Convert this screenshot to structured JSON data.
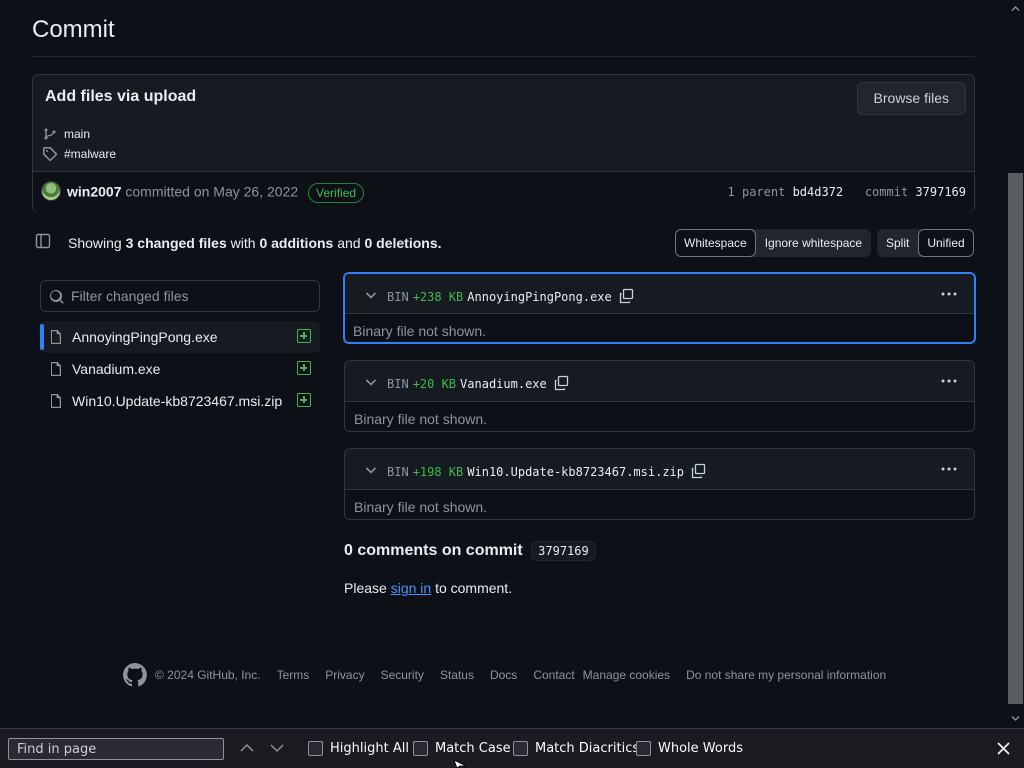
{
  "page": {
    "title": "Commit"
  },
  "commit": {
    "message": "Add files via upload",
    "browse_label": "Browse files",
    "branch": "main",
    "tag": "#malware",
    "author": "win2007",
    "committed_text": "committed on May 26, 2022",
    "verified": "Verified",
    "parent_label": "1 parent",
    "parent_sha": "bd4d372",
    "commit_label": "commit",
    "commit_sha": "3797169"
  },
  "summary": {
    "showing": "Showing",
    "count": "3",
    "changed_files": "changed files",
    "with": "with",
    "additions": "0 additions",
    "and": "and",
    "deletions": "0 deletions",
    "period": "."
  },
  "whitespace": {
    "whitespace": "Whitespace",
    "ignore": "Ignore whitespace"
  },
  "view": {
    "split": "Split",
    "unified": "Unified"
  },
  "filter": {
    "placeholder": "Filter changed files"
  },
  "files": [
    {
      "name": "AnnoyingPingPong.exe",
      "size": "+238 KB",
      "type": "BIN",
      "note": "Binary file not shown."
    },
    {
      "name": "Vanadium.exe",
      "size": "+20 KB",
      "type": "BIN",
      "note": "Binary file not shown."
    },
    {
      "name": "Win10.Update-kb8723467.msi.zip",
      "size": "+198 KB",
      "type": "BIN",
      "note": "Binary file not shown."
    }
  ],
  "comments": {
    "title": "0 comments on commit",
    "sha": "3797169",
    "please": "Please",
    "sign_in": "sign in",
    "to_comment": "to comment."
  },
  "footer": {
    "copyright": "© 2024 GitHub, Inc.",
    "links": [
      "Terms",
      "Privacy",
      "Security",
      "Status",
      "Docs",
      "Contact",
      "Manage cookies",
      "Do not share my personal information"
    ]
  },
  "findbar": {
    "placeholder": "Find in page",
    "highlight_all": "Highlight All",
    "match_case": "Match Case",
    "match_diacritics": "Match Diacritics",
    "whole_words": "Whole Words"
  },
  "colors": {
    "accent": "#2f81f7",
    "added": "#3fb950",
    "bg": "#0d1117"
  }
}
